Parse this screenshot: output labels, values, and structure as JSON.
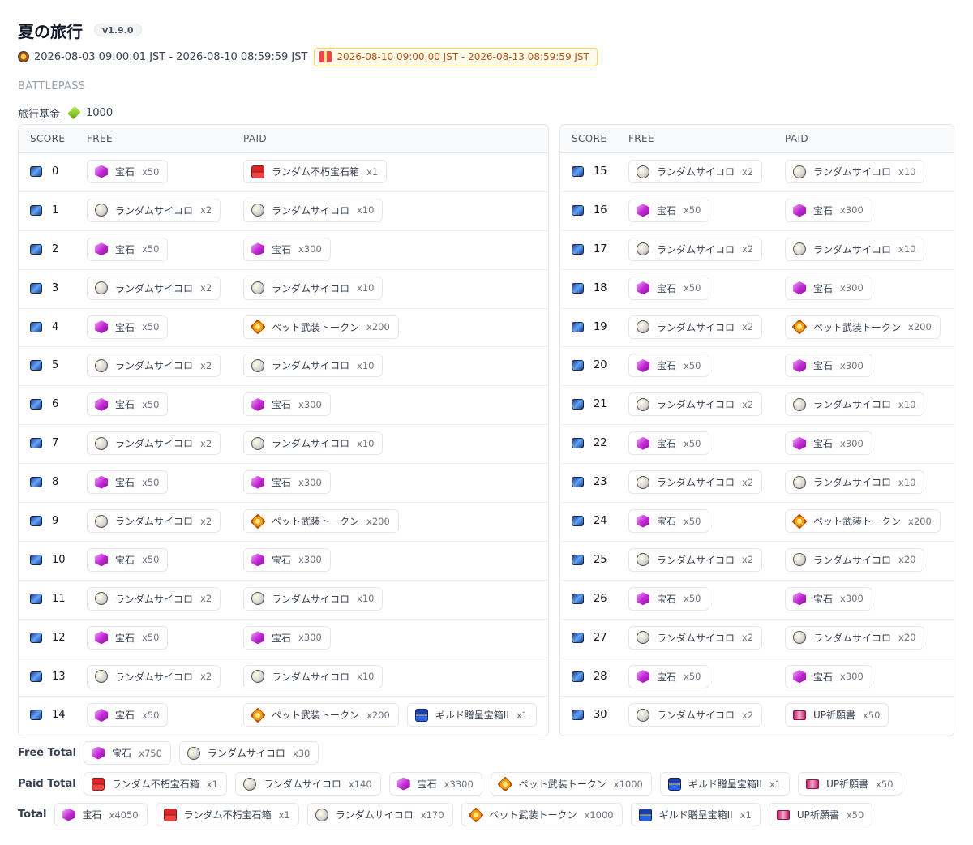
{
  "header": {
    "title": "夏の旅行",
    "version": "v1.9.0",
    "period": "2026-08-03 09:00:01 JST - 2026-08-10 08:59:59 JST",
    "claim_period": "2026-08-10 09:00:00 JST - 2026-08-13 08:59:59 JST"
  },
  "section_label": "BATTLEPASS",
  "fund": {
    "label": "旅行基金",
    "value": "1000"
  },
  "columns": {
    "score": "SCORE",
    "free": "FREE",
    "paid": "PAID"
  },
  "icons": {
    "宝石": "gem-icon",
    "ランダムサイコロ": "dice-icon",
    "ペット武装トークン": "pet-token-icon",
    "ランダム不朽宝石箱": "red-chest-icon",
    "ギルド贈呈宝箱II": "blue-chest-icon",
    "UP祈願書": "ticket-icon"
  },
  "rows": [
    {
      "score": "0",
      "free": [
        {
          "name": "宝石",
          "qty": "x50"
        }
      ],
      "paid": [
        {
          "name": "ランダム不朽宝石箱",
          "qty": "x1"
        }
      ]
    },
    {
      "score": "1",
      "free": [
        {
          "name": "ランダムサイコロ",
          "qty": "x2"
        }
      ],
      "paid": [
        {
          "name": "ランダムサイコロ",
          "qty": "x10"
        }
      ]
    },
    {
      "score": "2",
      "free": [
        {
          "name": "宝石",
          "qty": "x50"
        }
      ],
      "paid": [
        {
          "name": "宝石",
          "qty": "x300"
        }
      ]
    },
    {
      "score": "3",
      "free": [
        {
          "name": "ランダムサイコロ",
          "qty": "x2"
        }
      ],
      "paid": [
        {
          "name": "ランダムサイコロ",
          "qty": "x10"
        }
      ]
    },
    {
      "score": "4",
      "free": [
        {
          "name": "宝石",
          "qty": "x50"
        }
      ],
      "paid": [
        {
          "name": "ペット武装トークン",
          "qty": "x200"
        }
      ]
    },
    {
      "score": "5",
      "free": [
        {
          "name": "ランダムサイコロ",
          "qty": "x2"
        }
      ],
      "paid": [
        {
          "name": "ランダムサイコロ",
          "qty": "x10"
        }
      ]
    },
    {
      "score": "6",
      "free": [
        {
          "name": "宝石",
          "qty": "x50"
        }
      ],
      "paid": [
        {
          "name": "宝石",
          "qty": "x300"
        }
      ]
    },
    {
      "score": "7",
      "free": [
        {
          "name": "ランダムサイコロ",
          "qty": "x2"
        }
      ],
      "paid": [
        {
          "name": "ランダムサイコロ",
          "qty": "x10"
        }
      ]
    },
    {
      "score": "8",
      "free": [
        {
          "name": "宝石",
          "qty": "x50"
        }
      ],
      "paid": [
        {
          "name": "宝石",
          "qty": "x300"
        }
      ]
    },
    {
      "score": "9",
      "free": [
        {
          "name": "ランダムサイコロ",
          "qty": "x2"
        }
      ],
      "paid": [
        {
          "name": "ペット武装トークン",
          "qty": "x200"
        }
      ]
    },
    {
      "score": "10",
      "free": [
        {
          "name": "宝石",
          "qty": "x50"
        }
      ],
      "paid": [
        {
          "name": "宝石",
          "qty": "x300"
        }
      ]
    },
    {
      "score": "11",
      "free": [
        {
          "name": "ランダムサイコロ",
          "qty": "x2"
        }
      ],
      "paid": [
        {
          "name": "ランダムサイコロ",
          "qty": "x10"
        }
      ]
    },
    {
      "score": "12",
      "free": [
        {
          "name": "宝石",
          "qty": "x50"
        }
      ],
      "paid": [
        {
          "name": "宝石",
          "qty": "x300"
        }
      ]
    },
    {
      "score": "13",
      "free": [
        {
          "name": "ランダムサイコロ",
          "qty": "x2"
        }
      ],
      "paid": [
        {
          "name": "ランダムサイコロ",
          "qty": "x10"
        }
      ]
    },
    {
      "score": "14",
      "free": [
        {
          "name": "宝石",
          "qty": "x50"
        }
      ],
      "paid": [
        {
          "name": "ペット武装トークン",
          "qty": "x200"
        },
        {
          "name": "ギルド贈呈宝箱II",
          "qty": "x1"
        }
      ]
    },
    {
      "score": "15",
      "free": [
        {
          "name": "ランダムサイコロ",
          "qty": "x2"
        }
      ],
      "paid": [
        {
          "name": "ランダムサイコロ",
          "qty": "x10"
        }
      ]
    },
    {
      "score": "16",
      "free": [
        {
          "name": "宝石",
          "qty": "x50"
        }
      ],
      "paid": [
        {
          "name": "宝石",
          "qty": "x300"
        }
      ]
    },
    {
      "score": "17",
      "free": [
        {
          "name": "ランダムサイコロ",
          "qty": "x2"
        }
      ],
      "paid": [
        {
          "name": "ランダムサイコロ",
          "qty": "x10"
        }
      ]
    },
    {
      "score": "18",
      "free": [
        {
          "name": "宝石",
          "qty": "x50"
        }
      ],
      "paid": [
        {
          "name": "宝石",
          "qty": "x300"
        }
      ]
    },
    {
      "score": "19",
      "free": [
        {
          "name": "ランダムサイコロ",
          "qty": "x2"
        }
      ],
      "paid": [
        {
          "name": "ペット武装トークン",
          "qty": "x200"
        }
      ]
    },
    {
      "score": "20",
      "free": [
        {
          "name": "宝石",
          "qty": "x50"
        }
      ],
      "paid": [
        {
          "name": "宝石",
          "qty": "x300"
        }
      ]
    },
    {
      "score": "21",
      "free": [
        {
          "name": "ランダムサイコロ",
          "qty": "x2"
        }
      ],
      "paid": [
        {
          "name": "ランダムサイコロ",
          "qty": "x10"
        }
      ]
    },
    {
      "score": "22",
      "free": [
        {
          "name": "宝石",
          "qty": "x50"
        }
      ],
      "paid": [
        {
          "name": "宝石",
          "qty": "x300"
        }
      ]
    },
    {
      "score": "23",
      "free": [
        {
          "name": "ランダムサイコロ",
          "qty": "x2"
        }
      ],
      "paid": [
        {
          "name": "ランダムサイコロ",
          "qty": "x10"
        }
      ]
    },
    {
      "score": "24",
      "free": [
        {
          "name": "宝石",
          "qty": "x50"
        }
      ],
      "paid": [
        {
          "name": "ペット武装トークン",
          "qty": "x200"
        }
      ]
    },
    {
      "score": "25",
      "free": [
        {
          "name": "ランダムサイコロ",
          "qty": "x2"
        }
      ],
      "paid": [
        {
          "name": "ランダムサイコロ",
          "qty": "x20"
        }
      ]
    },
    {
      "score": "26",
      "free": [
        {
          "name": "宝石",
          "qty": "x50"
        }
      ],
      "paid": [
        {
          "name": "宝石",
          "qty": "x300"
        }
      ]
    },
    {
      "score": "27",
      "free": [
        {
          "name": "ランダムサイコロ",
          "qty": "x2"
        }
      ],
      "paid": [
        {
          "name": "ランダムサイコロ",
          "qty": "x20"
        }
      ]
    },
    {
      "score": "28",
      "free": [
        {
          "name": "宝石",
          "qty": "x50"
        }
      ],
      "paid": [
        {
          "name": "宝石",
          "qty": "x300"
        }
      ]
    },
    {
      "score": "30",
      "free": [
        {
          "name": "ランダムサイコロ",
          "qty": "x2"
        }
      ],
      "paid": [
        {
          "name": "UP祈願書",
          "qty": "x50"
        }
      ]
    }
  ],
  "totals": [
    {
      "label": "Free Total",
      "items": [
        {
          "name": "宝石",
          "qty": "x750"
        },
        {
          "name": "ランダムサイコロ",
          "qty": "x30"
        }
      ]
    },
    {
      "label": "Paid Total",
      "items": [
        {
          "name": "ランダム不朽宝石箱",
          "qty": "x1"
        },
        {
          "name": "ランダムサイコロ",
          "qty": "x140"
        },
        {
          "name": "宝石",
          "qty": "x3300"
        },
        {
          "name": "ペット武装トークン",
          "qty": "x1000"
        },
        {
          "name": "ギルド贈呈宝箱II",
          "qty": "x1"
        },
        {
          "name": "UP祈願書",
          "qty": "x50"
        }
      ]
    },
    {
      "label": "Total",
      "items": [
        {
          "name": "宝石",
          "qty": "x4050"
        },
        {
          "name": "ランダム不朽宝石箱",
          "qty": "x1"
        },
        {
          "name": "ランダムサイコロ",
          "qty": "x170"
        },
        {
          "name": "ペット武装トークン",
          "qty": "x1000"
        },
        {
          "name": "ギルド贈呈宝箱II",
          "qty": "x1"
        },
        {
          "name": "UP祈願書",
          "qty": "x50"
        }
      ]
    }
  ]
}
